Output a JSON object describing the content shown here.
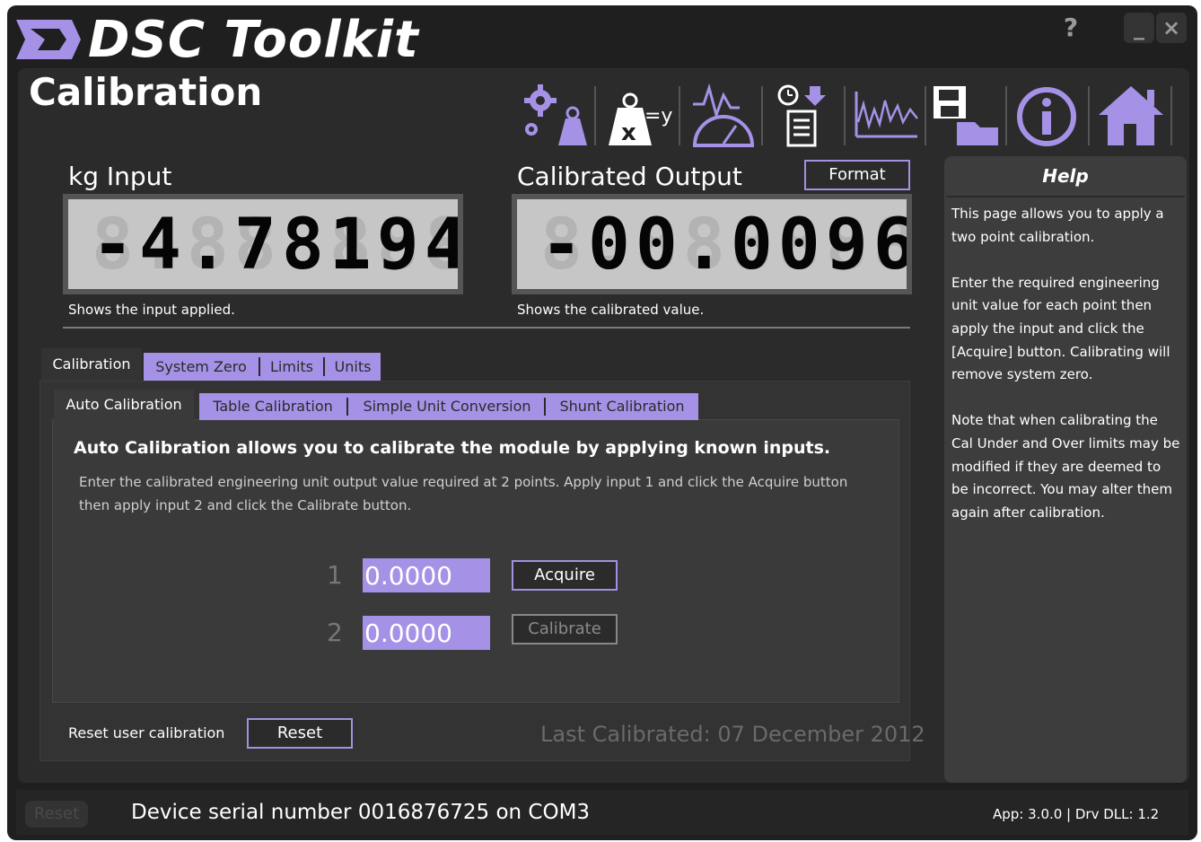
{
  "app": {
    "title": "DSC Toolkit",
    "help_button": "?",
    "minimize_button": "_",
    "close_button": "×"
  },
  "page": {
    "title": "Calibration"
  },
  "toolbar": {
    "icons": [
      "settings-weight-icon",
      "formula-icon",
      "gauge-icon",
      "logging-icon",
      "graph-icon",
      "save-load-icon",
      "info-icon",
      "home-icon"
    ]
  },
  "input_display": {
    "label": "kg Input",
    "ghost": "8.888888",
    "value": "-4.78194",
    "caption": "Shows the input applied."
  },
  "output_display": {
    "label": "Calibrated Output",
    "format_button": "Format",
    "ghost": "8.888888",
    "value": "-00.0096",
    "caption": "Shows the calibrated value."
  },
  "main_tabs": {
    "active": "Calibration",
    "others": [
      "System Zero",
      "Limits",
      "Units"
    ]
  },
  "sub_tabs": {
    "active": "Auto Calibration",
    "others": [
      "Table Calibration",
      "Simple Unit Conversion",
      "Shunt Calibration"
    ]
  },
  "auto_cal": {
    "headline": "Auto Calibration allows you to calibrate the module by applying known inputs.",
    "description": "Enter the calibrated engineering unit output value required at 2 points. Apply input 1 and click the Acquire button then apply input 2 and click the Calibrate button.",
    "rows": [
      {
        "num": "1",
        "value": "0.0000",
        "button": "Acquire"
      },
      {
        "num": "2",
        "value": "0.0000",
        "button": "Calibrate"
      }
    ]
  },
  "reset_section": {
    "label": "Reset user calibration",
    "button": "Reset"
  },
  "last_calibrated": "Last Calibrated: 07 December 2012",
  "help": {
    "title": "Help",
    "paragraphs": [
      "This page allows you to apply a two point calibration.",
      "Enter the required engineering unit value for each point then apply the input and click the [Acquire] button. Calibrating will remove system zero.",
      "Note that when calibrating the Cal Under and Over limits may be modified if they are deemed to be incorrect. You may alter them again after calibration."
    ]
  },
  "status": {
    "reset_button": "Reset",
    "serial_text": "Device serial number 0016876725 on COM3",
    "version": "App: 3.0.0 | Drv DLL: 1.2"
  },
  "colors": {
    "accent": "#a592e6",
    "background": "#1f1f1f",
    "panel": "#2b2b2b",
    "display_bg": "#c6c6c6"
  }
}
